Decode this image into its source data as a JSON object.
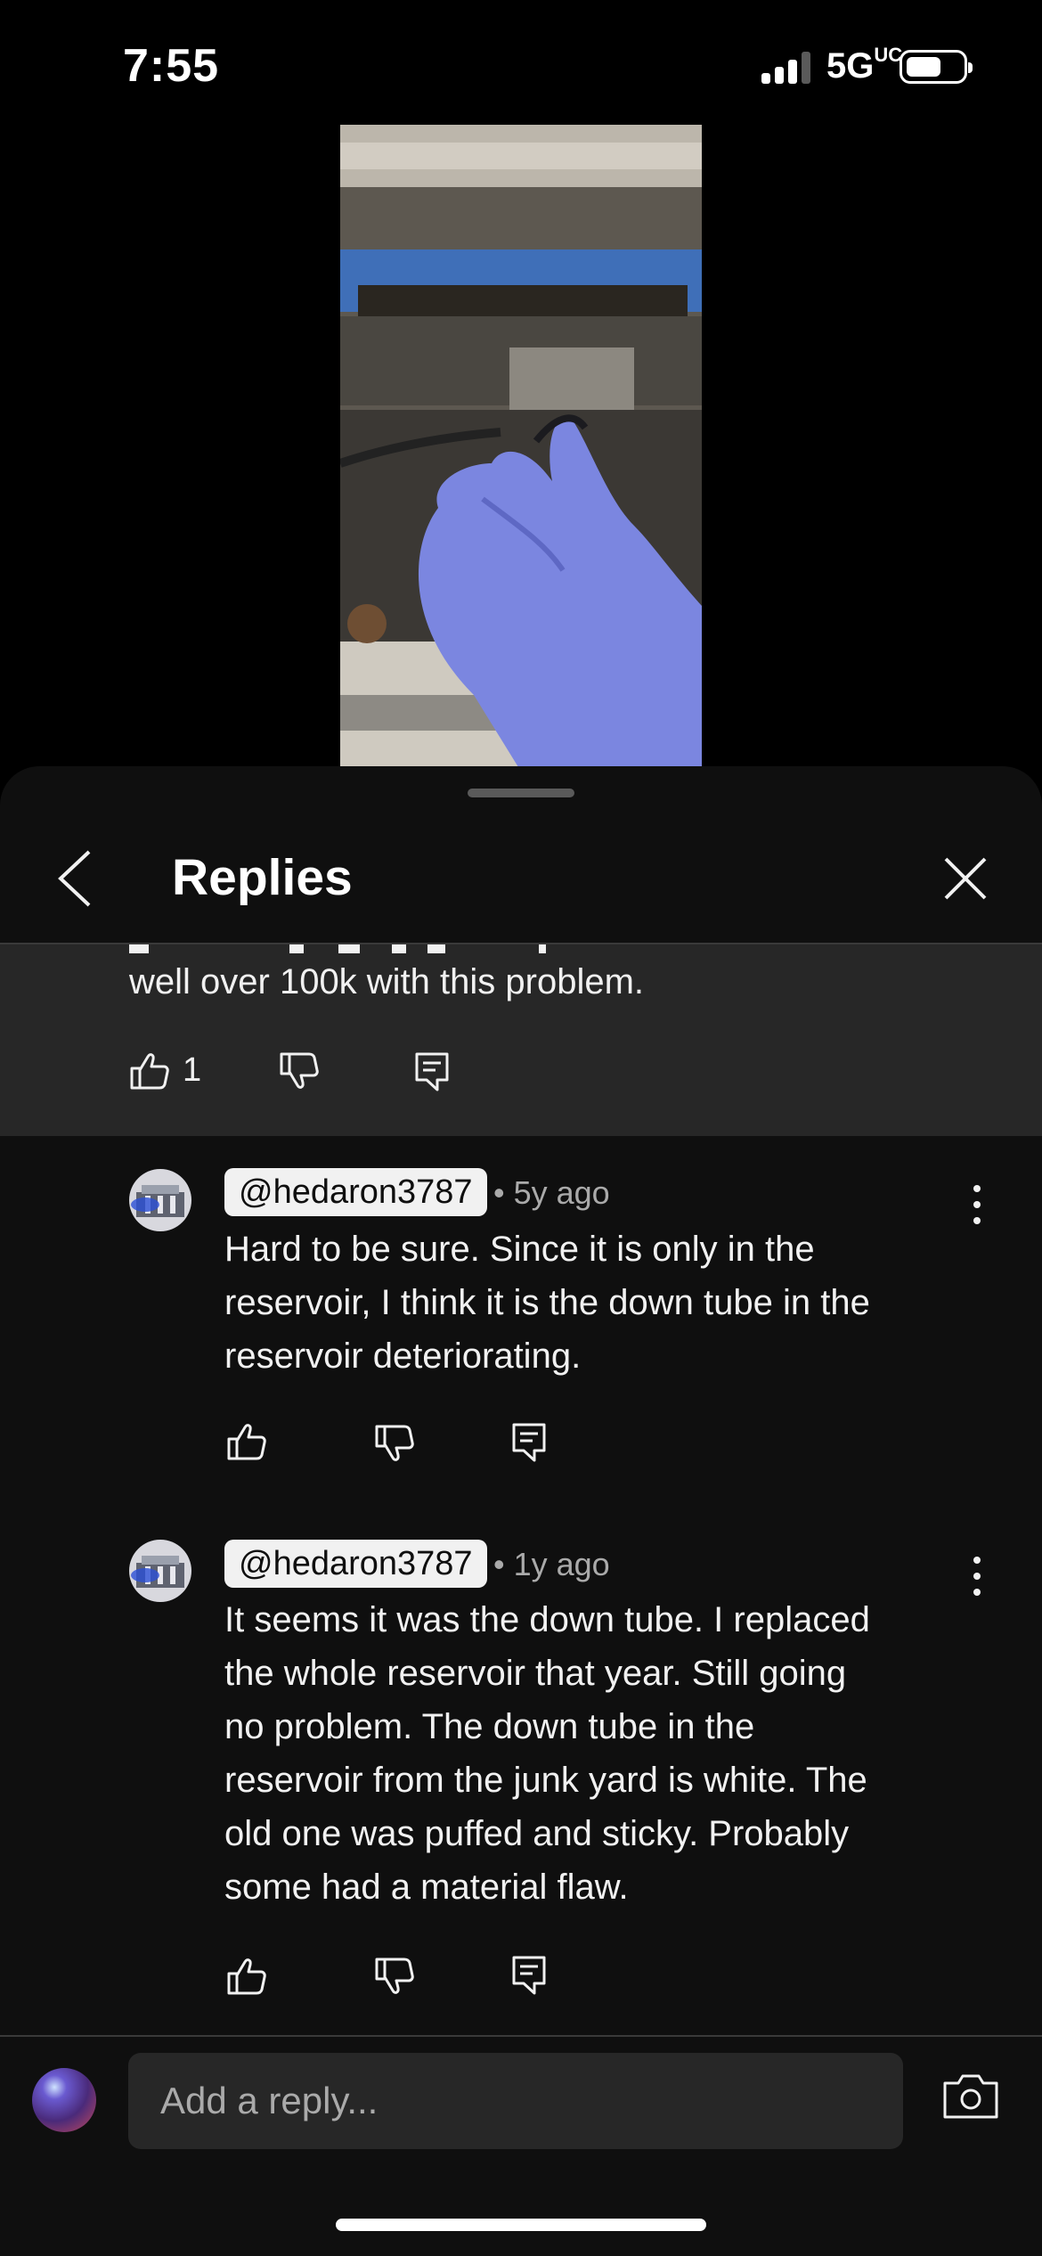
{
  "status_bar": {
    "time": "7:55",
    "network": "5G",
    "network_suffix": "UC"
  },
  "video": {
    "icon": "video-thumbnail-gloved-hand-engine"
  },
  "header": {
    "title": "Replies",
    "back_icon": "chevron-left-icon",
    "close_icon": "close-icon"
  },
  "parent_comment": {
    "text": "well over 100k with this problem.",
    "like_count": "1"
  },
  "replies": [
    {
      "handle": "@hedaron3787",
      "age": "• 5y ago",
      "lines": [
        "Hard to be sure.  Since it is only in the",
        "reservoir, I think it is the down tube in the",
        "reservoir deteriorating."
      ]
    },
    {
      "handle": "@hedaron3787",
      "age": "• 1y ago",
      "lines": [
        "It seems it was the down tube.  I replaced",
        "the whole reservoir that year.  Still going",
        "no problem.  The down tube in the",
        "reservoir from the junk yard is white.  The",
        "old one was puffed and sticky.  Probably",
        "some had a material flaw."
      ]
    }
  ],
  "composer": {
    "placeholder": "Add a reply...",
    "camera_icon": "camera-icon"
  },
  "colors": {
    "sheet_bg": "#0f0f0f",
    "highlight_bg": "#272727",
    "text": "#f1f1f1",
    "muted": "#aaaaaa"
  }
}
